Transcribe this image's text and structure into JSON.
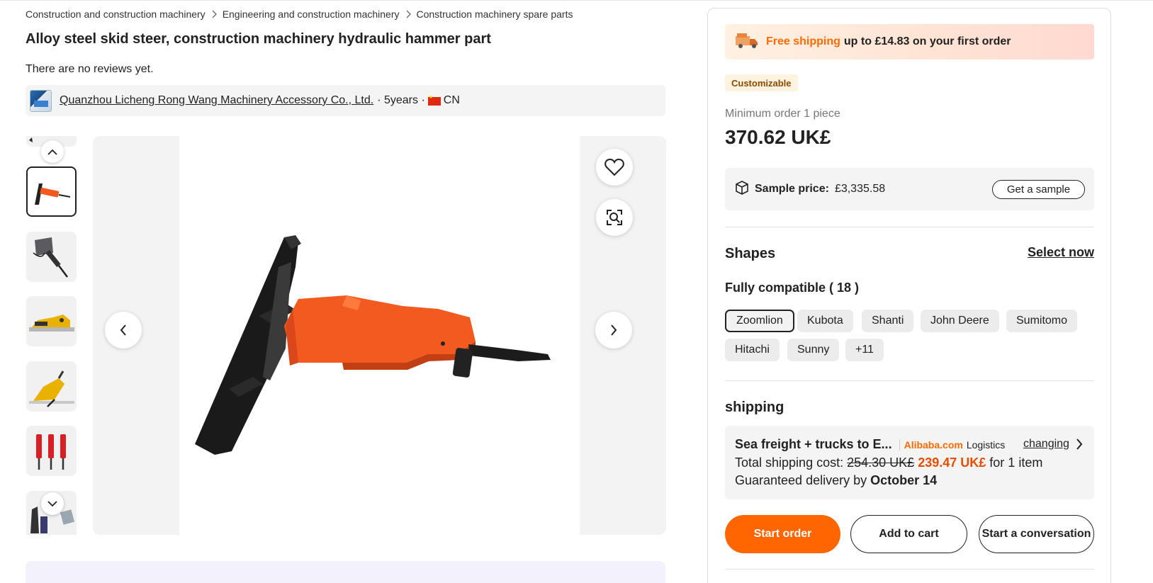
{
  "breadcrumb": [
    "Construction and construction machinery",
    "Engineering and construction machinery",
    "Construction machinery spare parts"
  ],
  "product": {
    "title": "Alloy steel skid steer, construction machinery hydraulic hammer part",
    "reviews_text": "There are no reviews yet."
  },
  "supplier": {
    "name": "Quanzhou Licheng Rong Wang Machinery Accessory Co., Ltd.",
    "years": "· 5years ·",
    "country": "CN"
  },
  "gallery": {
    "thumbnails": [
      {
        "name": "thumb-1",
        "active": true
      },
      {
        "name": "thumb-2",
        "active": false
      },
      {
        "name": "thumb-3",
        "active": false
      },
      {
        "name": "thumb-4",
        "active": false
      },
      {
        "name": "thumb-5",
        "active": false
      },
      {
        "name": "thumb-6",
        "active": false
      }
    ]
  },
  "promo": {
    "highlight": "Free shipping",
    "text": "up to £14.83 on your first order"
  },
  "pricing": {
    "badge": "Customizable",
    "min_order": "Minimum order 1 piece",
    "price": "370.62 UK£",
    "sample_label": "Sample price:",
    "sample_price": "£3,335.58",
    "sample_button": "Get a sample"
  },
  "shapes": {
    "title": "Shapes",
    "select_now": "Select now",
    "compat_label": "Fully compatible ( 18 )",
    "chips": [
      "Zoomlion",
      "Kubota",
      "Shanti",
      "John Deere",
      "Sumitomo",
      "Hitachi",
      "Sunny",
      "+11"
    ],
    "selected": "Zoomlion"
  },
  "shipping": {
    "title": "shipping",
    "method": "Sea freight + trucks to E...",
    "brand": "Alibaba.com",
    "brand_suffix": "Logistics",
    "change_link": "changing",
    "cost_label": "Total shipping cost:",
    "old_cost": "254.30 UK£",
    "new_cost": "239.47 UK£",
    "cost_suffix": "for 1 item",
    "delivery_label": "Guaranteed delivery by",
    "delivery_date": "October 14"
  },
  "actions": {
    "start_order": "Start order",
    "add_to_cart": "Add to cart",
    "start_conversation": "Start a conversation"
  },
  "colors": {
    "accent": "#ff6600",
    "price_orange": "#e64d00",
    "hammer_orange": "#f25a1f"
  },
  "icons": [
    "chevron-right-icon",
    "chevron-up-icon",
    "chevron-down-icon",
    "chevron-left-icon",
    "heart-icon",
    "image-search-icon",
    "box-icon",
    "truck-icon"
  ]
}
